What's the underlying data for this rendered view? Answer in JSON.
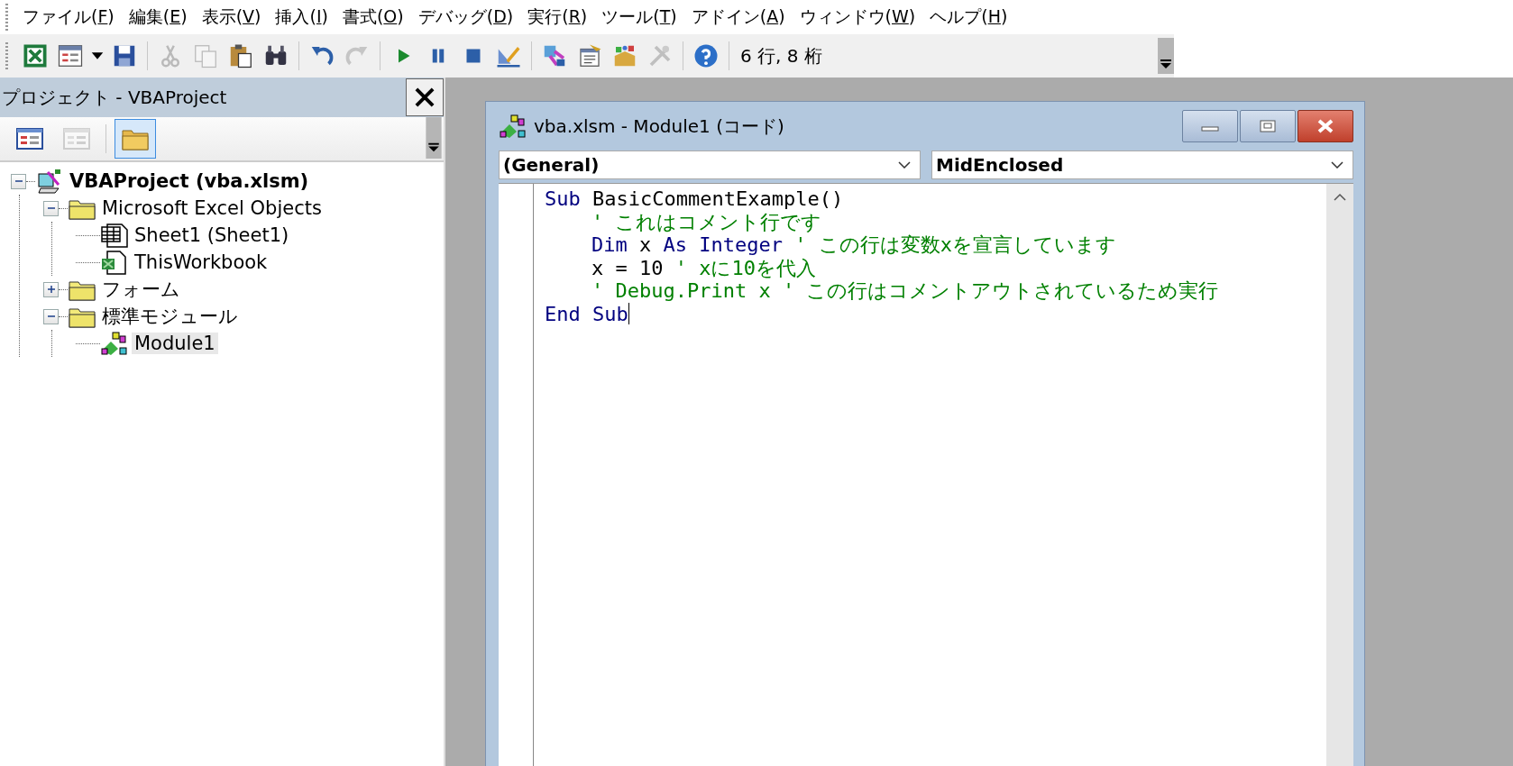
{
  "menu": [
    {
      "before": "ファイル(",
      "key": "F",
      "after": ")"
    },
    {
      "before": "編集(",
      "key": "E",
      "after": ")"
    },
    {
      "before": "表示(",
      "key": "V",
      "after": ")"
    },
    {
      "before": "挿入(",
      "key": "I",
      "after": ")"
    },
    {
      "before": "書式(",
      "key": "O",
      "after": ")"
    },
    {
      "before": "デバッグ(",
      "key": "D",
      "after": ")"
    },
    {
      "before": "実行(",
      "key": "R",
      "after": ")"
    },
    {
      "before": "ツール(",
      "key": "T",
      "after": ")"
    },
    {
      "before": "アドイン(",
      "key": "A",
      "after": ")"
    },
    {
      "before": "ウィンドウ(",
      "key": "W",
      "after": ")"
    },
    {
      "before": "ヘルプ(",
      "key": "H",
      "after": ")"
    }
  ],
  "toolbar": [
    {
      "kind": "excel",
      "disabled": false
    },
    {
      "kind": "insert-form",
      "disabled": false
    },
    {
      "kind": "save",
      "disabled": false
    },
    {
      "kind": "separator"
    },
    {
      "kind": "cut",
      "disabled": true
    },
    {
      "kind": "copy",
      "disabled": true
    },
    {
      "kind": "paste",
      "disabled": false
    },
    {
      "kind": "find",
      "disabled": false
    },
    {
      "kind": "separator"
    },
    {
      "kind": "undo",
      "disabled": false
    },
    {
      "kind": "redo",
      "disabled": true
    },
    {
      "kind": "separator"
    },
    {
      "kind": "run",
      "disabled": false
    },
    {
      "kind": "pause",
      "disabled": false
    },
    {
      "kind": "stop",
      "disabled": false
    },
    {
      "kind": "design",
      "disabled": false
    },
    {
      "kind": "separator"
    },
    {
      "kind": "explorer",
      "disabled": false
    },
    {
      "kind": "properties",
      "disabled": false
    },
    {
      "kind": "browser",
      "disabled": false
    },
    {
      "kind": "toolbox",
      "disabled": true
    },
    {
      "kind": "separator"
    },
    {
      "kind": "help",
      "disabled": false
    }
  ],
  "cursor_position": "6 行, 8 桁",
  "project_panel": {
    "title": "プロジェクト - VBAProject",
    "view_buttons": [
      {
        "kind": "view-code",
        "selected": false,
        "disabled": false
      },
      {
        "kind": "view-object",
        "selected": false,
        "disabled": true
      },
      {
        "kind": "toggle-folders",
        "selected": true,
        "disabled": false
      }
    ],
    "tree": [
      {
        "label": "VBAProject (vba.xlsm)",
        "kind": "project",
        "expanded": true,
        "selected": false,
        "children": [
          {
            "label": "Microsoft Excel Objects",
            "kind": "folder",
            "expanded": true,
            "selected": false,
            "children": [
              {
                "label": "Sheet1 (Sheet1)",
                "kind": "sheet",
                "selected": false
              },
              {
                "label": "ThisWorkbook",
                "kind": "workbook",
                "selected": false
              }
            ]
          },
          {
            "label": "フォーム",
            "kind": "folder",
            "expanded": false,
            "selected": false
          },
          {
            "label": "標準モジュール",
            "kind": "folder",
            "expanded": true,
            "selected": false,
            "children": [
              {
                "label": "Module1",
                "kind": "module",
                "selected": true
              }
            ]
          }
        ]
      }
    ]
  },
  "code_window": {
    "title": "vba.xlsm - Module1 (コード)",
    "object_dropdown": "(General)",
    "procedure_dropdown": "MidEnclosed",
    "lines": [
      {
        "indent": false,
        "tokens": [
          {
            "kind": "keyword",
            "text": "Sub"
          },
          {
            "kind": "plain",
            "text": " BasicCommentExample()"
          }
        ]
      },
      {
        "indent": true,
        "tokens": [
          {
            "kind": "comment",
            "text": "' これはコメント行です"
          }
        ]
      },
      {
        "indent": true,
        "tokens": [
          {
            "kind": "keyword",
            "text": "Dim"
          },
          {
            "kind": "plain",
            "text": " x "
          },
          {
            "kind": "keyword",
            "text": "As Integer"
          },
          {
            "kind": "comment",
            "text": " ' この行は変数xを宣言しています"
          }
        ]
      },
      {
        "indent": true,
        "tokens": [
          {
            "kind": "plain",
            "text": "x = 10 "
          },
          {
            "kind": "comment",
            "text": "' xに10を代入"
          }
        ]
      },
      {
        "indent": true,
        "tokens": [
          {
            "kind": "comment",
            "text": "' Debug.Print x ' この行はコメントアウトされているため実行"
          }
        ]
      },
      {
        "indent": false,
        "caret": true,
        "tokens": [
          {
            "kind": "keyword",
            "text": "End Sub"
          }
        ]
      }
    ]
  }
}
